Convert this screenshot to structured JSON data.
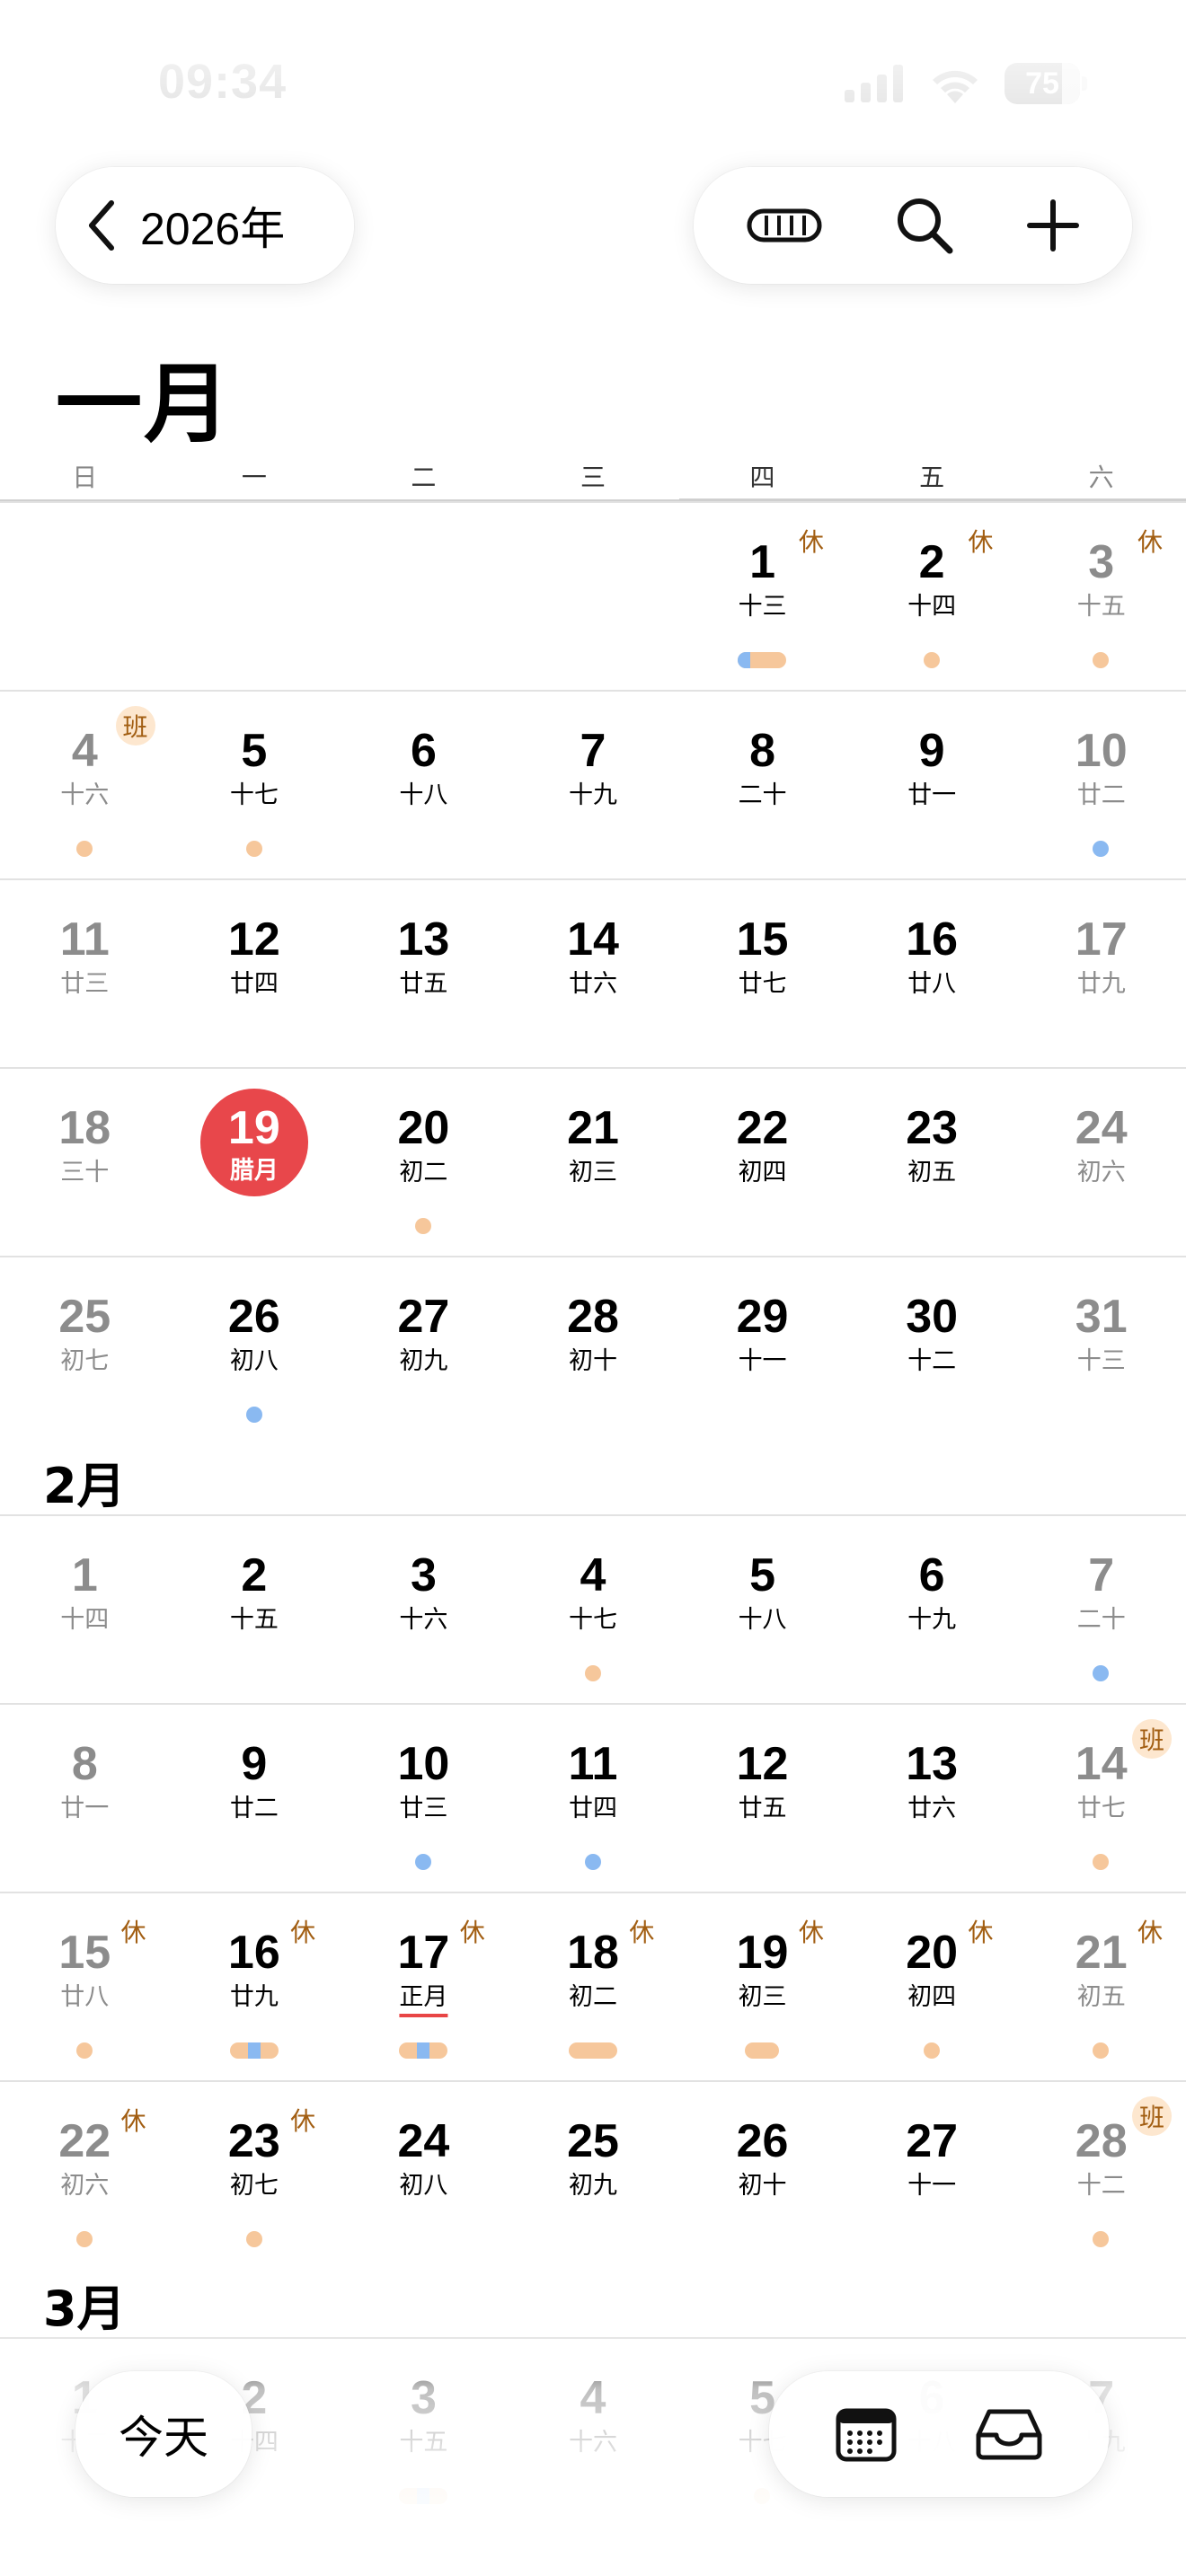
{
  "status": {
    "time": "09:34",
    "battery": "75"
  },
  "header": {
    "year_label": "2026年"
  },
  "weekdays": [
    "日",
    "一",
    "二",
    "三",
    "四",
    "五",
    "六"
  ],
  "months": [
    {
      "label": "一月"
    },
    {
      "label": "2月"
    },
    {
      "label": "3月"
    }
  ],
  "weeks": [
    [
      null,
      null,
      null,
      null,
      {
        "d": "1",
        "l": "十三",
        "badge": "休",
        "ev": "bar-mix"
      },
      {
        "d": "2",
        "l": "十四",
        "badge": "休",
        "ev": "or"
      },
      {
        "d": "3",
        "l": "十五",
        "badge": "休",
        "ev": "or"
      }
    ],
    [
      {
        "d": "4",
        "l": "十六",
        "badge": "班",
        "ev": "or"
      },
      {
        "d": "5",
        "l": "十七",
        "ev": "or"
      },
      {
        "d": "6",
        "l": "十八"
      },
      {
        "d": "7",
        "l": "十九"
      },
      {
        "d": "8",
        "l": "二十"
      },
      {
        "d": "9",
        "l": "廿一"
      },
      {
        "d": "10",
        "l": "廿二",
        "ev": "bl"
      }
    ],
    [
      {
        "d": "11",
        "l": "廿三"
      },
      {
        "d": "12",
        "l": "廿四"
      },
      {
        "d": "13",
        "l": "廿五"
      },
      {
        "d": "14",
        "l": "廿六"
      },
      {
        "d": "15",
        "l": "廿七"
      },
      {
        "d": "16",
        "l": "廿八"
      },
      {
        "d": "17",
        "l": "廿九"
      }
    ],
    [
      {
        "d": "18",
        "l": "三十"
      },
      {
        "d": "19",
        "l": "腊月",
        "today": true
      },
      {
        "d": "20",
        "l": "初二",
        "ev": "or"
      },
      {
        "d": "21",
        "l": "初三"
      },
      {
        "d": "22",
        "l": "初四"
      },
      {
        "d": "23",
        "l": "初五"
      },
      {
        "d": "24",
        "l": "初六"
      }
    ],
    [
      {
        "d": "25",
        "l": "初七"
      },
      {
        "d": "26",
        "l": "初八",
        "ev": "bl"
      },
      {
        "d": "27",
        "l": "初九"
      },
      {
        "d": "28",
        "l": "初十"
      },
      {
        "d": "29",
        "l": "十一"
      },
      {
        "d": "30",
        "l": "十二"
      },
      {
        "d": "31",
        "l": "十三"
      }
    ],
    [
      {
        "d": "1",
        "l": "十四"
      },
      {
        "d": "2",
        "l": "十五"
      },
      {
        "d": "3",
        "l": "十六"
      },
      {
        "d": "4",
        "l": "十七",
        "ev": "or"
      },
      {
        "d": "5",
        "l": "十八"
      },
      {
        "d": "6",
        "l": "十九"
      },
      {
        "d": "7",
        "l": "二十",
        "ev": "bl"
      }
    ],
    [
      {
        "d": "8",
        "l": "廿一"
      },
      {
        "d": "9",
        "l": "廿二"
      },
      {
        "d": "10",
        "l": "廿三",
        "ev": "bl"
      },
      {
        "d": "11",
        "l": "廿四",
        "ev": "bl"
      },
      {
        "d": "12",
        "l": "廿五"
      },
      {
        "d": "13",
        "l": "廿六"
      },
      {
        "d": "14",
        "l": "廿七",
        "badge": "班",
        "ev": "or"
      }
    ],
    [
      {
        "d": "15",
        "l": "廿八",
        "badge": "休",
        "ev": "or"
      },
      {
        "d": "16",
        "l": "廿九",
        "badge": "休",
        "ev": "bar-mix-c"
      },
      {
        "d": "17",
        "l": "正月",
        "badge": "休",
        "ev": "bar-mix-c",
        "festival": true
      },
      {
        "d": "18",
        "l": "初二",
        "badge": "休",
        "ev": "bar"
      },
      {
        "d": "19",
        "l": "初三",
        "badge": "休",
        "ev": "bar-s"
      },
      {
        "d": "20",
        "l": "初四",
        "badge": "休",
        "ev": "or"
      },
      {
        "d": "21",
        "l": "初五",
        "badge": "休",
        "ev": "or"
      }
    ],
    [
      {
        "d": "22",
        "l": "初六",
        "badge": "休",
        "ev": "or"
      },
      {
        "d": "23",
        "l": "初七",
        "badge": "休",
        "ev": "or"
      },
      {
        "d": "24",
        "l": "初八"
      },
      {
        "d": "25",
        "l": "初九"
      },
      {
        "d": "26",
        "l": "初十"
      },
      {
        "d": "27",
        "l": "十一"
      },
      {
        "d": "28",
        "l": "十二",
        "badge": "班",
        "ev": "or"
      }
    ],
    [
      {
        "d": "1",
        "l": "十二"
      },
      {
        "d": "2",
        "l": "十四"
      },
      {
        "d": "3",
        "l": "十五",
        "ev": "bar-mix-c"
      },
      {
        "d": "4",
        "l": "十六"
      },
      {
        "d": "5",
        "l": "十七",
        "ev": "or"
      },
      {
        "d": "6",
        "l": "十八"
      },
      {
        "d": "7",
        "l": "十九"
      }
    ]
  ],
  "footer": {
    "today_label": "今天"
  }
}
